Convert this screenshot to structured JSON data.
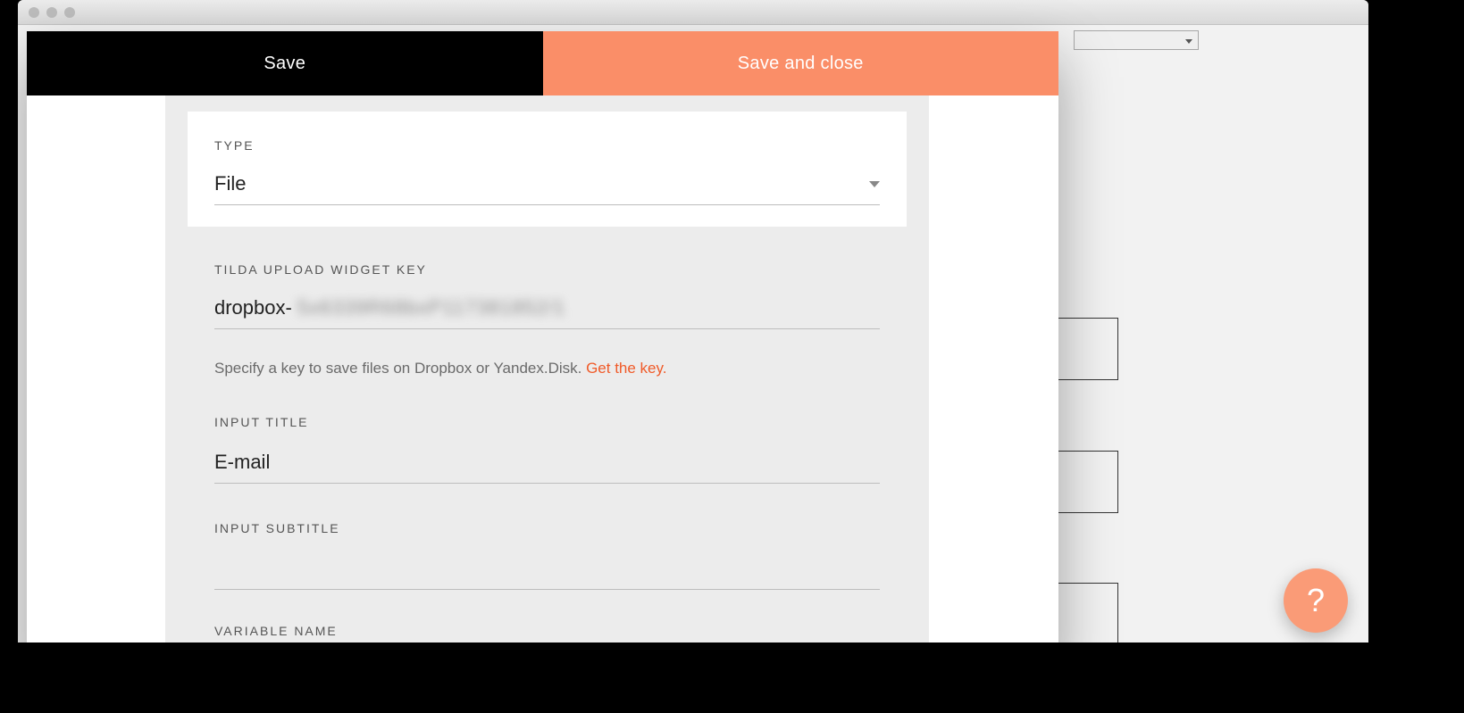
{
  "header": {
    "save_label": "Save",
    "save_close_label": "Save and close"
  },
  "type_field": {
    "label": "TYPE",
    "value": "File"
  },
  "upload_key": {
    "label": "TILDA UPLOAD WIDGET KEY",
    "prefix": "dropbox-",
    "masked_value": "5x6339R68bxP117381852/1",
    "helper_text": "Specify a key to save files on Dropbox or Yandex.Disk. ",
    "helper_link": "Get the key."
  },
  "input_title": {
    "label": "INPUT TITLE",
    "value": "E-mail"
  },
  "input_subtitle": {
    "label": "INPUT SUBTITLE",
    "value": ""
  },
  "variable_name": {
    "label": "VARIABLE NAME"
  },
  "help_fab": {
    "glyph": "?"
  }
}
